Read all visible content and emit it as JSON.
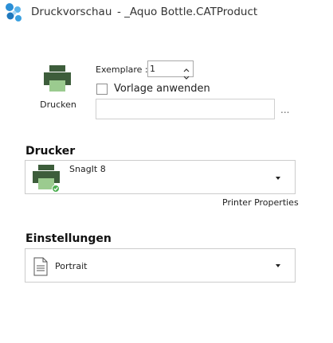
{
  "window": {
    "title": "Druckvorschau",
    "document": "- _Aquo Bottle.CATProduct"
  },
  "print": {
    "button_label": "Drucken",
    "copies_label": "Exemplare :",
    "copies_value": "1",
    "template_label": "Vorlage anwenden",
    "template_checked": false,
    "template_path": "",
    "browse_label": "..."
  },
  "printer": {
    "section_title": "Drucker",
    "selected": "SnagIt 8",
    "status": "ready",
    "properties_link": "Printer Properties"
  },
  "settings": {
    "section_title": "Einstellungen",
    "orientation": "Portrait"
  },
  "colors": {
    "printer_icon": "#3d5d3b",
    "printer_paper": "#9bcb8f",
    "status_ok": "#4caf50",
    "app_icon": "#2b8fd6"
  },
  "icons": {
    "app": "app-logo-icon",
    "print": "printer-icon",
    "printer_device": "printer-device-icon",
    "status": "check-badge-icon",
    "document": "document-icon",
    "spin_up": "spin-up-icon",
    "spin_down": "spin-down-icon",
    "dropdown": "dropdown-arrow-icon"
  }
}
